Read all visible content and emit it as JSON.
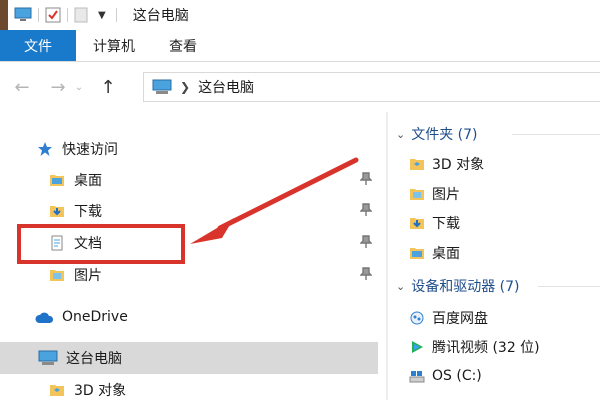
{
  "window": {
    "title": "这台电脑"
  },
  "ribbon": {
    "tabs": [
      {
        "label": "文件",
        "active": true
      },
      {
        "label": "计算机",
        "active": false
      },
      {
        "label": "查看",
        "active": false
      }
    ]
  },
  "address": {
    "path": "这台电脑"
  },
  "nav": {
    "quick_access": "快速访问",
    "items": [
      {
        "label": "桌面",
        "icon": "desktop-folder-icon",
        "pinned": true
      },
      {
        "label": "下载",
        "icon": "downloads-folder-icon",
        "pinned": true
      },
      {
        "label": "文档",
        "icon": "documents-folder-icon",
        "pinned": true
      },
      {
        "label": "图片",
        "icon": "pictures-folder-icon",
        "pinned": true
      }
    ],
    "onedrive": "OneDrive",
    "this_pc": "这台电脑",
    "sub_item": "3D 对象"
  },
  "content": {
    "folders_header": "文件夹 (7)",
    "folders": [
      "3D 对象",
      "图片",
      "下载",
      "桌面"
    ],
    "devices_header": "设备和驱动器 (7)",
    "devices": [
      "百度网盘",
      "腾讯视频 (32 位)",
      "OS (C:)"
    ]
  },
  "colors": {
    "accent": "#1979ca",
    "annotation": "#d9342b",
    "selection": "#d9d9d9"
  }
}
